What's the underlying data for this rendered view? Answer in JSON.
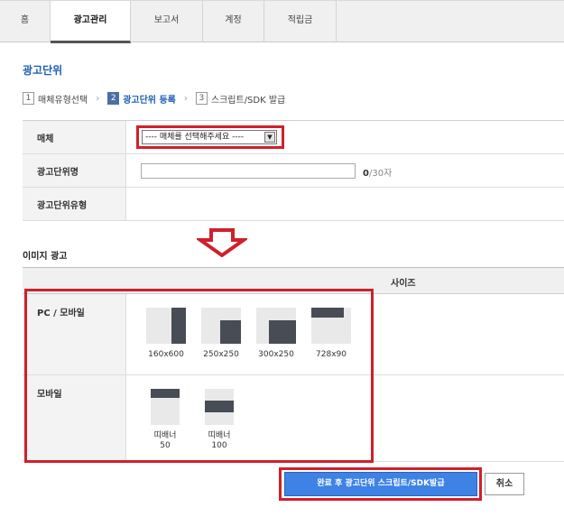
{
  "nav": {
    "tabs": [
      {
        "label": "홈",
        "active": false
      },
      {
        "label": "광고관리",
        "active": true
      },
      {
        "label": "보고서",
        "active": false
      },
      {
        "label": "계정",
        "active": false
      },
      {
        "label": "적립금",
        "active": false
      }
    ]
  },
  "page": {
    "title": "광고단위"
  },
  "steps": [
    {
      "num": "1",
      "label": "매체유형선택",
      "active": false
    },
    {
      "num": "2",
      "label": "광고단위 등록",
      "active": true
    },
    {
      "num": "3",
      "label": "스크립트/SDK 발급",
      "active": false
    }
  ],
  "form": {
    "media_label": "매체",
    "media_select_value": "---- 매체를 선택해주세요 ----",
    "ad_unit_name_label": "광고단위명",
    "ad_unit_name_value": "",
    "counter_current": "0",
    "counter_max": "/30자",
    "ad_unit_type_label": "광고단위유형"
  },
  "image_ad": {
    "section_title": "이미지 광고",
    "size_header": "사이즈",
    "pc_mobile_label": "PC / 모바일",
    "pc_mobile_sizes": [
      "160x600",
      "250x250",
      "300x250",
      "728x90"
    ],
    "mobile_label": "모바일",
    "mobile_sizes": [
      {
        "line1": "띠배너",
        "line2": "50"
      },
      {
        "line1": "띠배너",
        "line2": "100"
      }
    ]
  },
  "actions": {
    "submit_label": "완료 후 광고단위 스크립트/SDK발급",
    "cancel_label": "취소"
  },
  "colors": {
    "accent_blue": "#3e82e6",
    "highlight_red": "#d0202b",
    "title_blue": "#1f5fb5",
    "thumb_dark": "#474c55",
    "thumb_light": "#e9e9e9"
  }
}
